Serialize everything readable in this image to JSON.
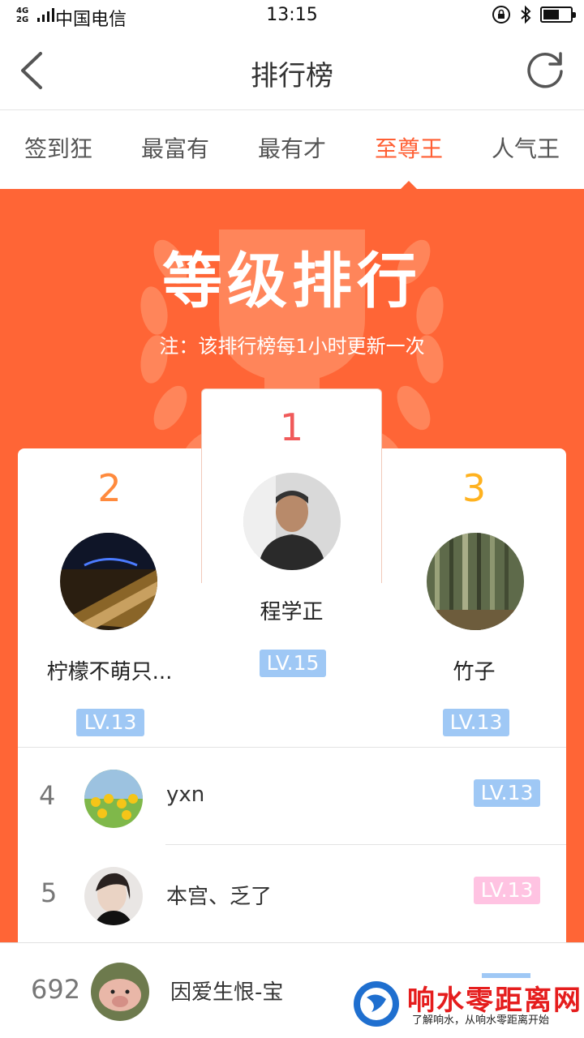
{
  "status": {
    "network": "4G",
    "network2": "2G",
    "carrier": "中国电信",
    "time": "13:15",
    "battery_level": 0.6
  },
  "nav": {
    "title": "排行榜"
  },
  "tabs": [
    {
      "label": "签到狂",
      "active": false
    },
    {
      "label": "最富有",
      "active": false
    },
    {
      "label": "最有才",
      "active": false
    },
    {
      "label": "至尊王",
      "active": true
    },
    {
      "label": "人气王",
      "active": false
    }
  ],
  "hero": {
    "title": "等级排行",
    "note": "注：该排行榜每1小时更新一次"
  },
  "podium": [
    {
      "rank": "1",
      "name": "程学正",
      "level": "LV.15",
      "rank_color": "#f05a5a"
    },
    {
      "rank": "2",
      "name": "柠檬不萌只...",
      "level": "LV.13",
      "rank_color": "#ff8a3d"
    },
    {
      "rank": "3",
      "name": "竹子",
      "level": "LV.13",
      "rank_color": "#ffb21f"
    }
  ],
  "list": [
    {
      "rank": "4",
      "name": "yxn",
      "level": "LV.13",
      "level_color": "#9fc8f5"
    },
    {
      "rank": "5",
      "name": "本宫、乏了",
      "level": "LV.13",
      "level_color": "#ffc3e2"
    }
  ],
  "me": {
    "rank": "692",
    "name": "因爱生恨-宝"
  },
  "watermark": {
    "title": "响水零距离网",
    "subtitle": "了解响水，从响水零距离开始"
  },
  "colors": {
    "accent": "#ff6536",
    "active_tab": "#ff5f34",
    "level_badge": "#9fc8f5"
  }
}
